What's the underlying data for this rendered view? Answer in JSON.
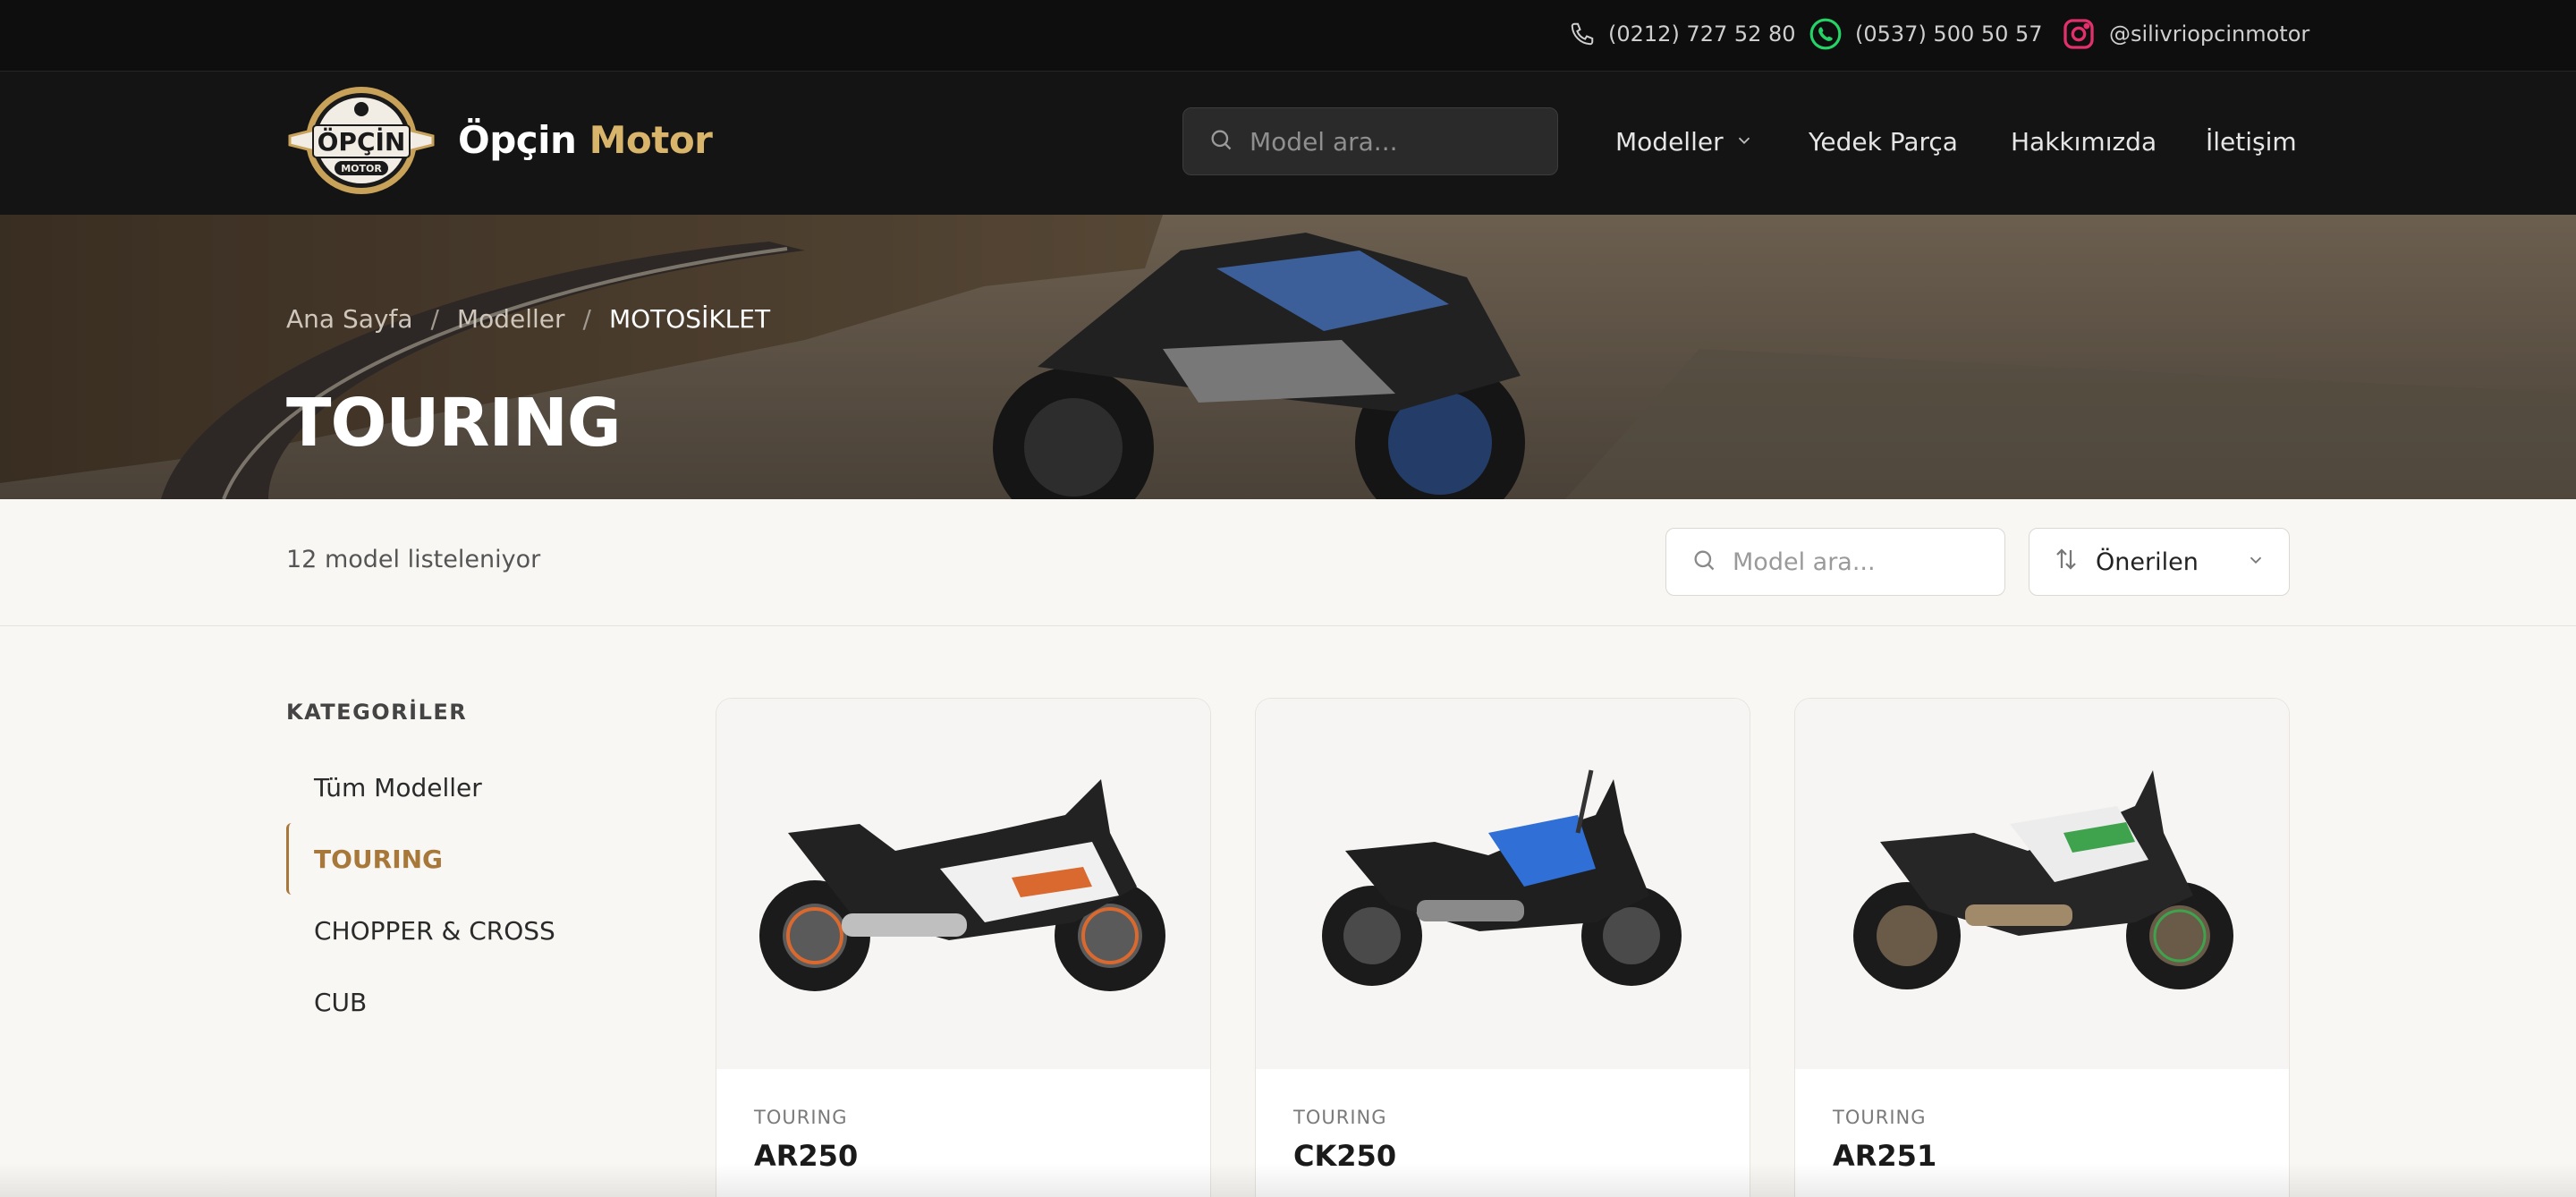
{
  "topbar": {
    "phone": "(0212) 727 52 80",
    "whatsapp": "(0537) 500 50 57",
    "instagram": "@silivriopcinmotor",
    "icons": [
      "phone-icon",
      "whatsapp-icon",
      "instagram-icon"
    ],
    "colors": {
      "whatsapp": "#25d366",
      "instagram": "#e1306c"
    }
  },
  "header": {
    "logo_text": "ÖPÇİN",
    "logo_sub": "MOTOR",
    "brand_main": "Öpçin",
    "brand_accent": "Motor",
    "search_placeholder": "Model ara...",
    "nav": {
      "models": "Modeller",
      "parts": "Yedek Parça",
      "about": "Hakkımızda",
      "contact": "İletişim"
    },
    "accent_color": "#d9b46b"
  },
  "hero": {
    "breadcrumb": {
      "home": "Ana Sayfa",
      "models": "Modeller",
      "current": "MOTOSİKLET",
      "separator": "/"
    },
    "title": "TOURING"
  },
  "toolbar": {
    "count_text": "12 model listeleniyor",
    "search_placeholder": "Model ara...",
    "sort_selected": "Önerilen"
  },
  "sidebar": {
    "title": "KATEGORİLER",
    "items": [
      {
        "label": "Tüm Modeller",
        "active": false
      },
      {
        "label": "TOURING",
        "active": true
      },
      {
        "label": "CHOPPER & CROSS",
        "active": false
      },
      {
        "label": "CUB",
        "active": false
      }
    ],
    "active_color": "#a8783b"
  },
  "products": [
    {
      "category": "TOURING",
      "name": "AR250",
      "color": "#e8e8e8"
    },
    {
      "category": "TOURING",
      "name": "CK250",
      "color": "#2f6fd6"
    },
    {
      "category": "TOURING",
      "name": "AR251",
      "color": "#3fa34d"
    }
  ]
}
